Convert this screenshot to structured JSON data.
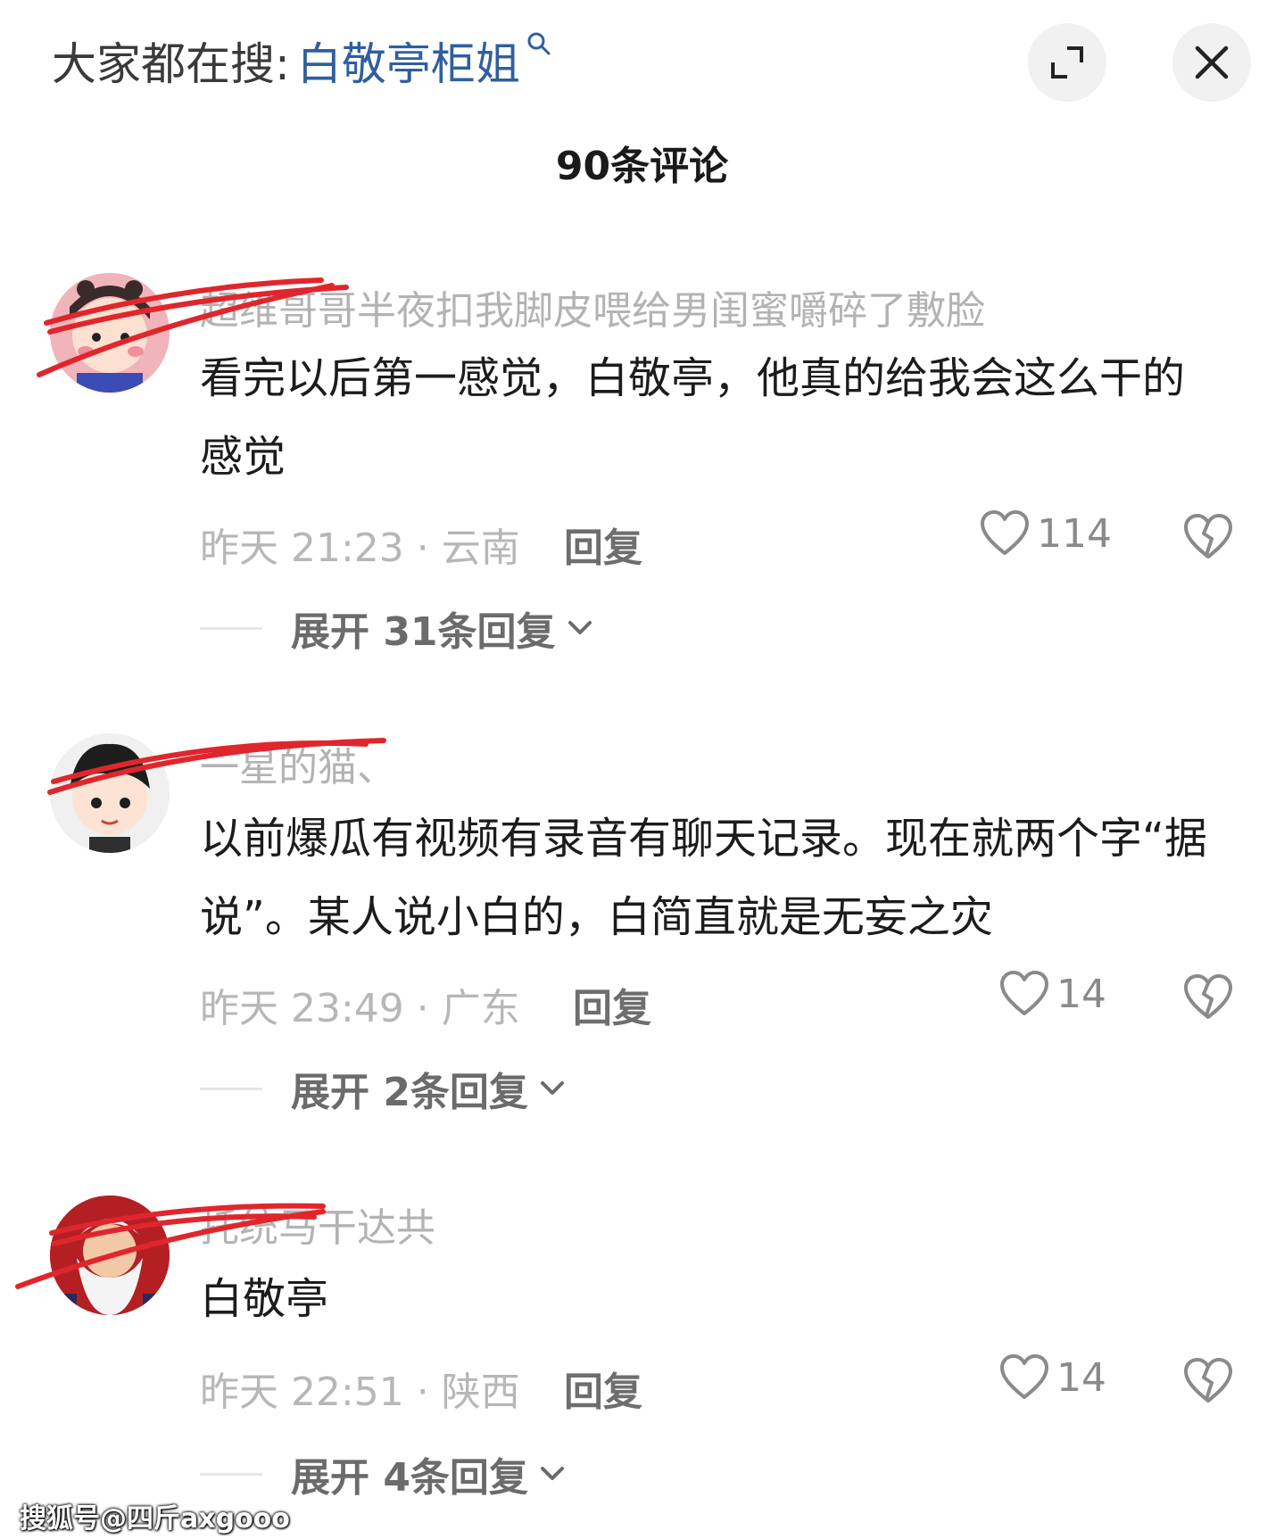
{
  "header": {
    "search_prefix": "大家都在搜:",
    "search_term": "白敬亭柜姐",
    "comments_title": "90条评论"
  },
  "comments": [
    {
      "username": "超维哥哥半夜扣我脚皮喂给男闺蜜嚼碎了敷脸",
      "text": "看完以后第一感觉，白敬亭，他真的给我会这么干的感觉",
      "meta": "昨天 21:23 · 云南",
      "reply_label": "回复",
      "likes": "114",
      "expand_label": "展开 31条回复"
    },
    {
      "username": "一星的猫、",
      "text": "以前爆瓜有视频有录音有聊天记录。现在就两个字“据说”。某人说小白的，白简直就是无妄之灾",
      "meta": "昨天 23:49 · 广东",
      "reply_label": "回复",
      "likes": "14",
      "expand_label": "展开 2条回复"
    },
    {
      "username": "托统马干达共",
      "text": "白敬亭",
      "meta": "昨天 22:51 · 陕西",
      "reply_label": "回复",
      "likes": "14",
      "expand_label": "展开 4条回复"
    }
  ],
  "watermark": "搜狐号@四斤axgooo",
  "colors": {
    "search_term": "#2f5f9e",
    "redaction": "#e0262d"
  }
}
